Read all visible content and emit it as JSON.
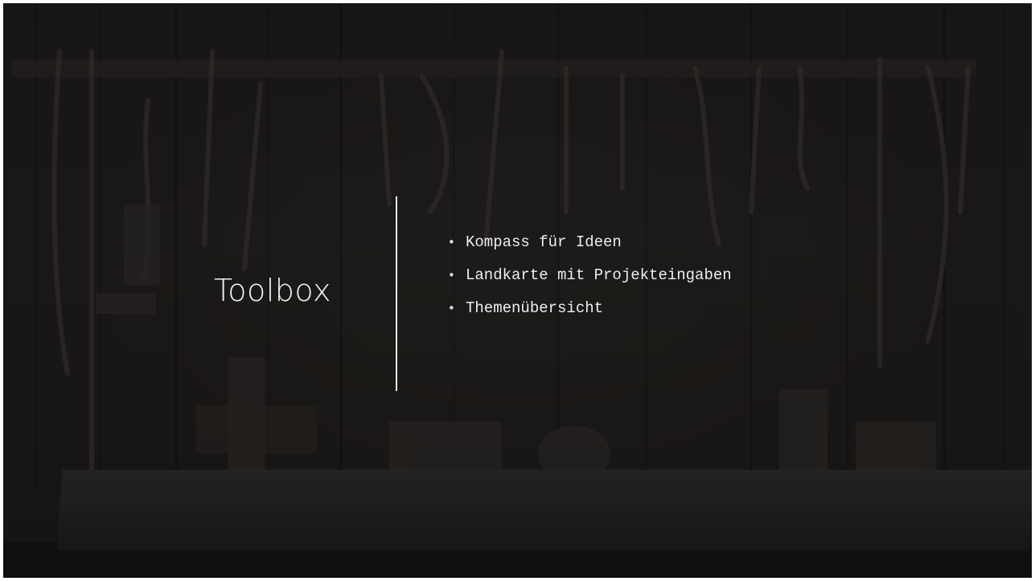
{
  "slide": {
    "title": "Toolbox",
    "bullets": [
      "Kompass für Ideen",
      "Landkarte mit Projekteingaben",
      "Themenübersicht"
    ]
  },
  "background": {
    "image_subject": "dark workshop wall with hanging tools and wooden workbench"
  },
  "colors": {
    "text": "#f2f2f2",
    "divider": "#e8e8e8",
    "background": "#1e1c1a"
  }
}
